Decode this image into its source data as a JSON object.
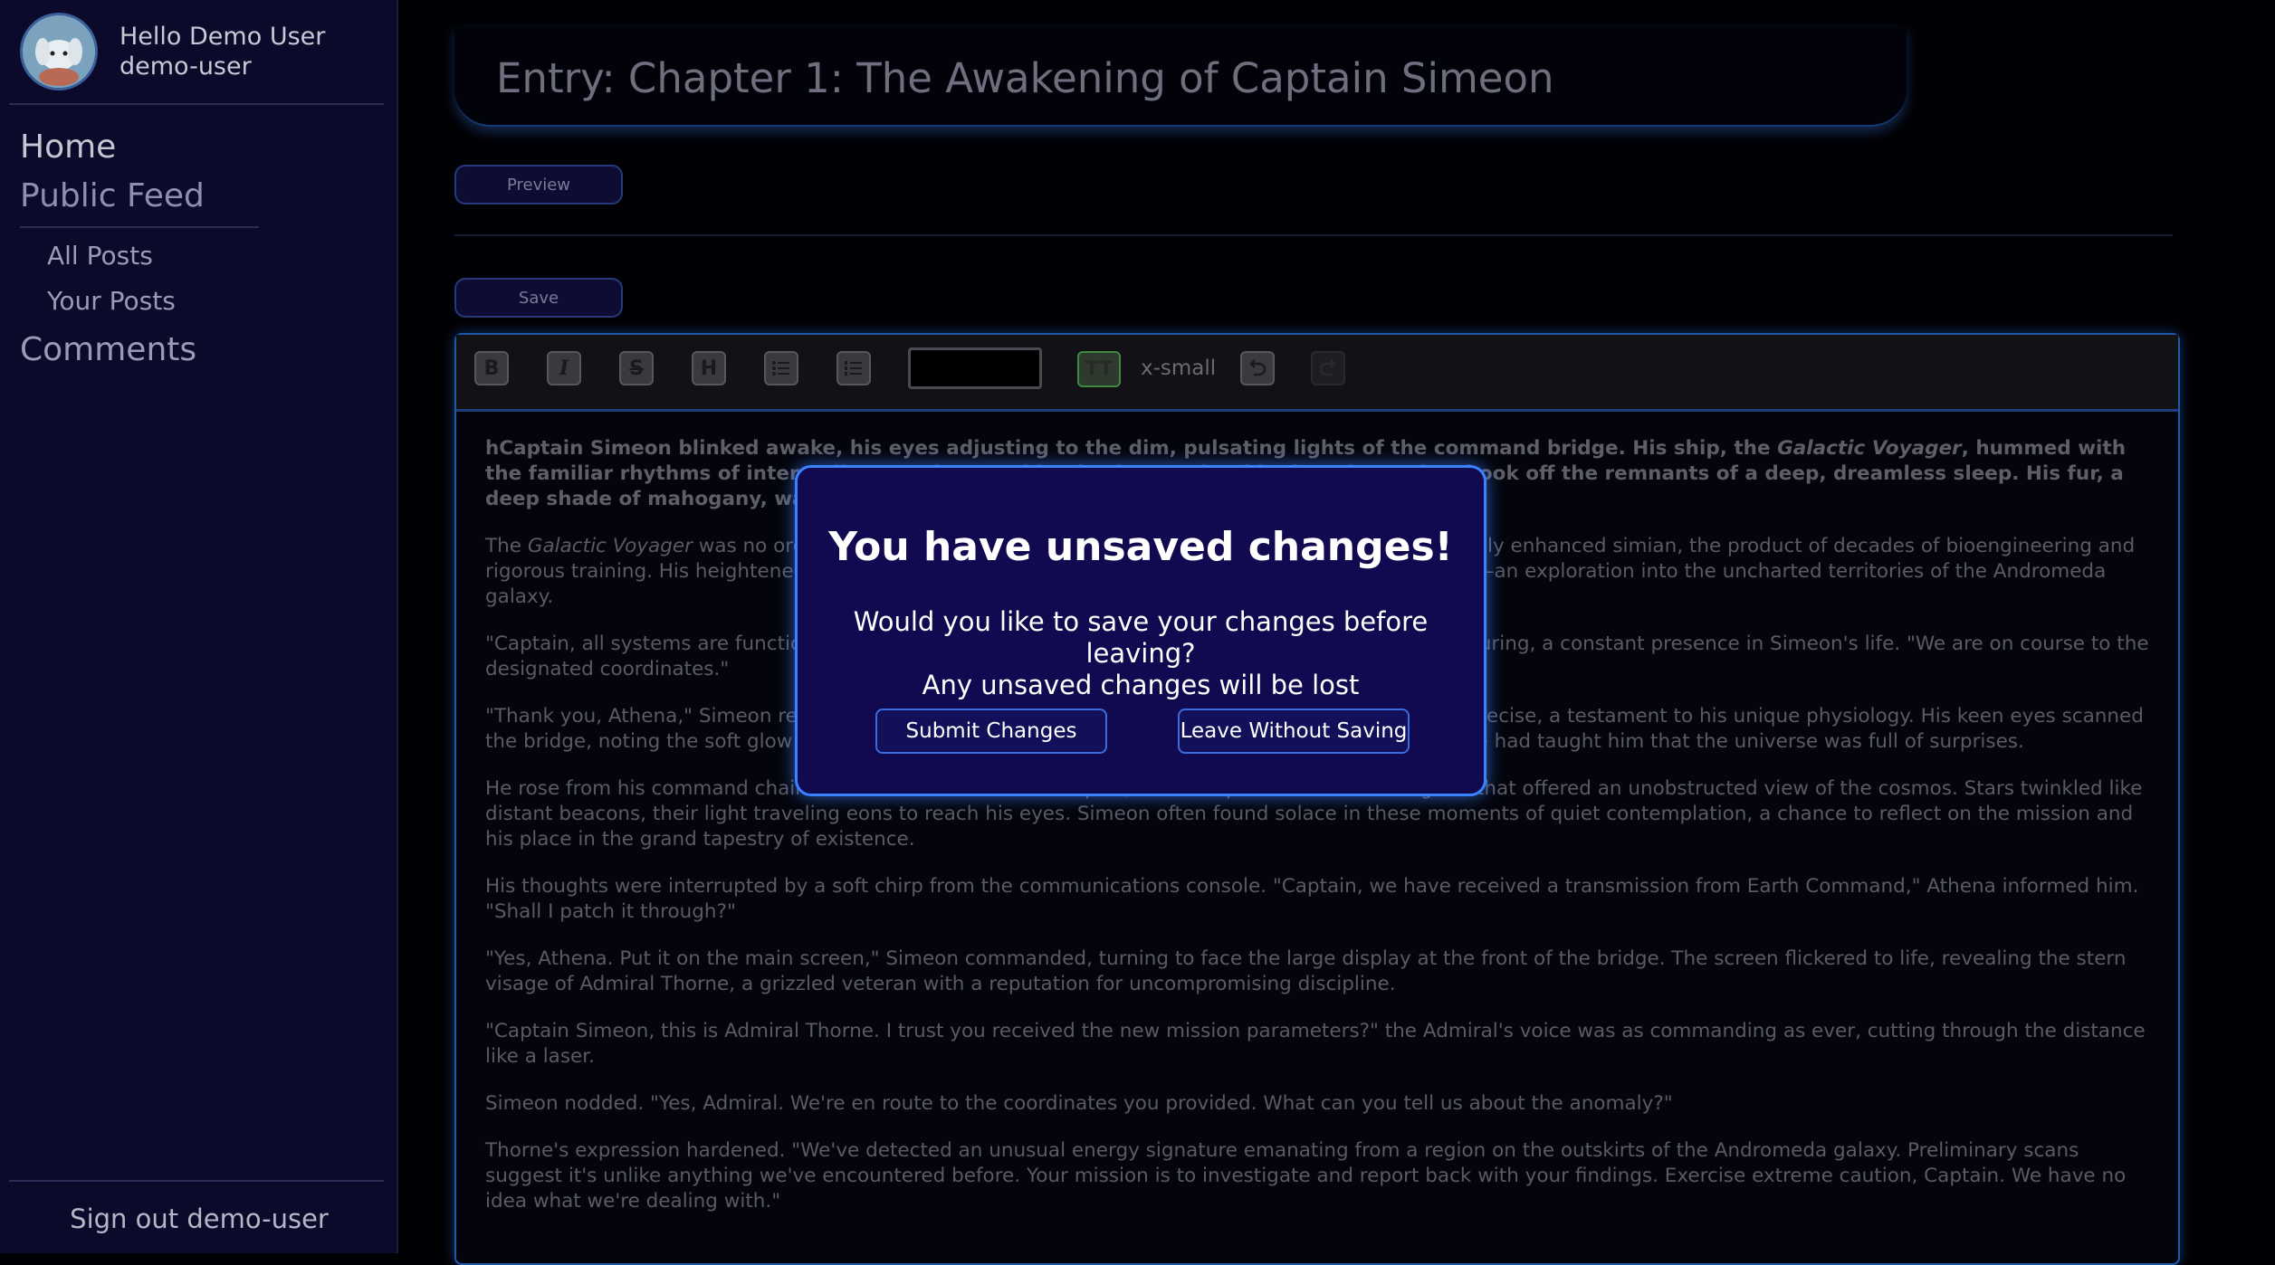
{
  "sidebar": {
    "greeting": "Hello Demo User",
    "username": "demo-user",
    "nav": {
      "home": "Home",
      "public_feed": "Public Feed",
      "all_posts": "All Posts",
      "your_posts": "Your Posts",
      "comments": "Comments"
    },
    "signout": "Sign out demo-user"
  },
  "header": {
    "title": "Entry: Chapter 1: The Awakening of Captain Simeon"
  },
  "actions": {
    "preview": "Preview",
    "save": "Save"
  },
  "toolbar": {
    "bold": "B",
    "italic": "I",
    "strike": "S",
    "heading": "H",
    "text_size_label": "x-small"
  },
  "content": {
    "p1_prefix": "hCaptain Simeon blinked awake, his eyes adjusting to the dim, pulsating lights of the command bridge. His ship, the ",
    "ship_name": "Galactic Voyager",
    "p1_rest": ", hummed with the familiar rhythms of interstellar travel, a soothing background to his thoughts as he shook off the remnants of a deep, dreamless sleep. His fur, a deep shade of mahogany, was slightly ruffled, a sign of his restless slumber.",
    "p2_prefix": "The ",
    "p2_rest": " was no ordinary vessel, and Simeon was no ordinary captain. He was a genetically enhanced simian, the product of decades of bioengineering and rigorous training. His heightened intelligence and agility made him the perfect leader for this mission—an exploration into the uncharted territories of the Andromeda galaxy.",
    "p3": "\"Captain, all systems are functioning within normal parameters,\" the AI's voice was smooth and reassuring, a constant presence in Simeon's life. \"We are on course to the designated coordinates.\"",
    "p4": "\"Thank you, Athena,\" Simeon replied, rising from his chair and stretching, each movement fluid and precise, a testament to his unique physiology. His keen eyes scanned the bridge, noting the soft glow of the consoles. Everything appeared in order, but years of experience had taught him that the universe was full of surprises.",
    "p5": "He rose from his command chair and walked over to the viewport, a vast expanse of reinforced glass that offered an unobstructed view of the cosmos. Stars twinkled like distant beacons, their light traveling eons to reach his eyes. Simeon often found solace in these moments of quiet contemplation, a chance to reflect on the mission and his place in the grand tapestry of existence.",
    "p6": "His thoughts were interrupted by a soft chirp from the communications console. \"Captain, we have received a transmission from Earth Command,\" Athena informed him. \"Shall I patch it through?\"",
    "p7": "\"Yes, Athena. Put it on the main screen,\" Simeon commanded, turning to face the large display at the front of the bridge. The screen flickered to life, revealing the stern visage of Admiral Thorne, a grizzled veteran with a reputation for uncompromising discipline.",
    "p8": "\"Captain Simeon, this is Admiral Thorne. I trust you received the new mission parameters?\" the Admiral's voice was as commanding as ever, cutting through the distance like a laser.",
    "p9": "Simeon nodded. \"Yes, Admiral. We're en route to the coordinates you provided. What can you tell us about the anomaly?\"",
    "p10": "Thorne's expression hardened. \"We've detected an unusual energy signature emanating from a region on the outskirts of the Andromeda galaxy. Preliminary scans suggest it's unlike anything we've encountered before. Your mission is to investigate and report back with your findings. Exercise extreme caution, Captain. We have no idea what we're dealing with.\""
  },
  "modal": {
    "title": "You have unsaved changes!",
    "line1": "Would you like to save your changes before leaving?",
    "line2": "Any unsaved changes will be lost",
    "submit": "Submit Changes",
    "leave": "Leave Without Saving"
  },
  "colors": {
    "sidebar_bg": "#0b0a2a",
    "modal_bg": "#110a50",
    "modal_border": "#3a82ff",
    "accent_blue": "#1e5aa8"
  }
}
